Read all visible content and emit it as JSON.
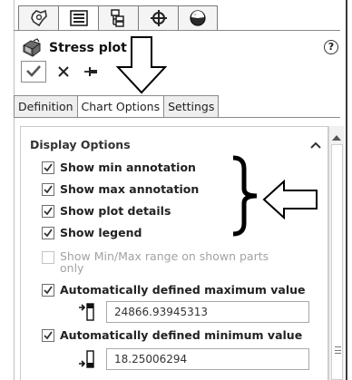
{
  "icon_tabs": [
    {
      "icon": "feature-manager-icon",
      "active": false
    },
    {
      "icon": "property-manager-icon",
      "active": true
    },
    {
      "icon": "configuration-manager-icon",
      "active": false
    },
    {
      "icon": "dimxpert-icon",
      "active": false
    },
    {
      "icon": "display-manager-icon",
      "active": false
    }
  ],
  "header": {
    "title": "Stress plot",
    "title_icon": "stress-plot-icon",
    "help": "?"
  },
  "actions": {
    "ok_icon": "checkmark-icon",
    "cancel_icon": "close-icon",
    "pin_icon": "pushpin-icon"
  },
  "tabs": [
    {
      "label": "Definition",
      "active": false
    },
    {
      "label": "Chart Options",
      "active": true
    },
    {
      "label": "Settings",
      "active": false
    }
  ],
  "display_options": {
    "header": "Display Options",
    "options": [
      {
        "label": "Show min annotation",
        "checked": true,
        "enabled": true
      },
      {
        "label": "Show max annotation",
        "checked": true,
        "enabled": true
      },
      {
        "label": "Show plot details",
        "checked": true,
        "enabled": true
      },
      {
        "label": "Show legend",
        "checked": true,
        "enabled": true
      },
      {
        "label": "Show Min/Max range on shown parts only",
        "checked": false,
        "enabled": false
      },
      {
        "label": "Automatically defined maximum value",
        "checked": true,
        "enabled": true
      },
      {
        "label": "Automatically defined minimum value",
        "checked": true,
        "enabled": true
      }
    ],
    "max_value": "24866.93945313",
    "min_value": "18.25006294"
  },
  "colors": {
    "accent": "#1a1a1a",
    "tab_border": "#8a8a8a",
    "disabled_text": "#a3a3a3"
  }
}
